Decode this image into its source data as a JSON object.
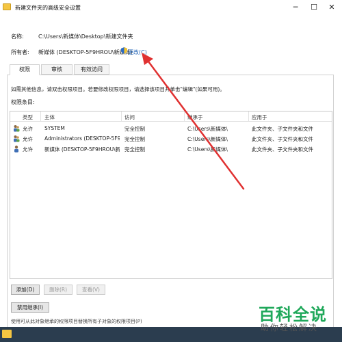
{
  "window": {
    "title": "新建文件夹的高级安全设置",
    "controls": {
      "minimize": "─",
      "maximize": "☐",
      "close": "✕"
    }
  },
  "info": {
    "name_label": "名称:",
    "name_value": "C:\\Users\\新媒体\\Desktop\\新建文件夹",
    "owner_label": "所有者:",
    "owner_value": "新媒体 (DESKTOP-5F9HROU\\新媒体)",
    "change_link": "更改(C)"
  },
  "tabs": [
    {
      "label": "权限",
      "active": true
    },
    {
      "label": "审核",
      "active": false
    },
    {
      "label": "有效访问",
      "active": false
    }
  ],
  "permissions": {
    "instruction": "如需其他信息，请双击权限项目。若要修改权限项目，请选择该项目并单击\"编辑\"(如果可用)。",
    "entries_label": "权限条目:",
    "columns": [
      "类型",
      "主体",
      "访问",
      "继承于",
      "应用于"
    ],
    "rows": [
      {
        "type": "允许",
        "principal": "SYSTEM",
        "access": "完全控制",
        "inherited": "C:\\Users\\新媒体\\",
        "applies": "此文件夹、子文件夹和文件"
      },
      {
        "type": "允许",
        "principal": "Administrators (DESKTOP-5F9HR...",
        "access": "完全控制",
        "inherited": "C:\\Users\\新媒体\\",
        "applies": "此文件夹、子文件夹和文件"
      },
      {
        "type": "允许",
        "principal": "新媒体 (DESKTOP-5F9HROU\\新媒...",
        "access": "完全控制",
        "inherited": "C:\\Users\\新媒体\\",
        "applies": "此文件夹、子文件夹和文件"
      }
    ]
  },
  "buttons": {
    "add": "添加(D)",
    "remove": "删除(R)",
    "view": "查看(V)",
    "disable_inheritance": "禁用继承(I)"
  },
  "bottom_text": "使用可从此对象继承的权限项目替换所有子对象的权限项目(P)",
  "watermark": {
    "title": "百科全说",
    "subtitle": "助你轻松解决"
  },
  "colors": {
    "link": "#1a5fb4",
    "arrow": "#e03131",
    "watermark": "#1fa85a",
    "taskbar": "#2b3d4f"
  }
}
